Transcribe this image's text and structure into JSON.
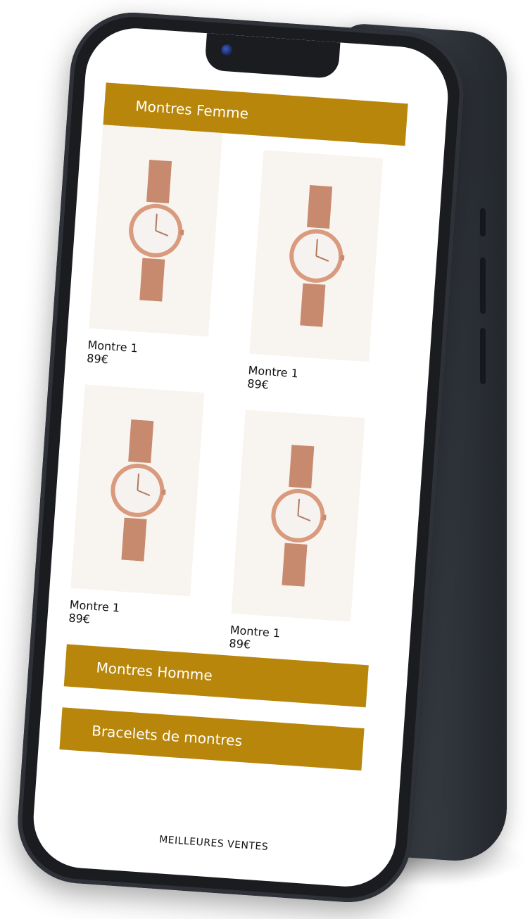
{
  "categories": {
    "women": "Montres Femme",
    "men": "Montres Homme",
    "bracelets": "Bracelets de montres"
  },
  "products": [
    {
      "name": "Montre 1",
      "price": "89€"
    },
    {
      "name": "Montre 1",
      "price": "89€"
    },
    {
      "name": "Montre 1",
      "price": "89€"
    },
    {
      "name": "Montre 1",
      "price": "89€"
    }
  ],
  "footer": {
    "label": "MEILLEURES VENTES"
  },
  "colors": {
    "accent": "#b8860b",
    "product_bg": "#f8f4ef",
    "phone_body": "#1a1c20"
  },
  "icons": [
    "camera-icon",
    "watch-image"
  ]
}
